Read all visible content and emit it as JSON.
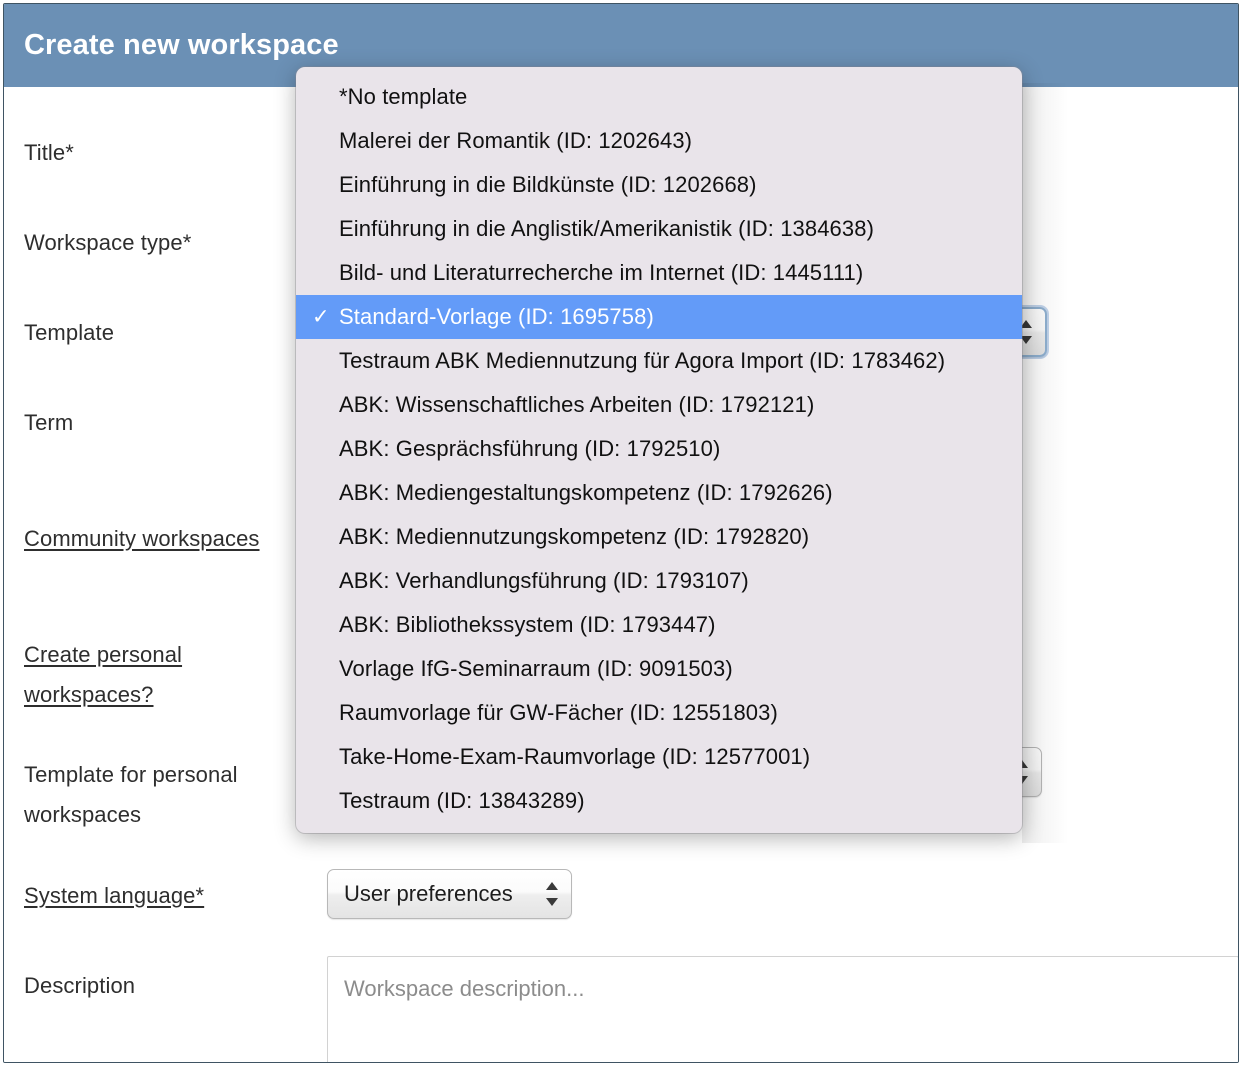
{
  "window": {
    "title": "Create new workspace"
  },
  "colors": {
    "titlebar": "#6b90b5",
    "menu_background": "#e9e4ea",
    "menu_selected": "#639bf8",
    "page_background": "#ffffff",
    "border": "#3f5463"
  },
  "form": {
    "fields": [
      {
        "label": "Title*",
        "link": false
      },
      {
        "label": "Workspace type*",
        "link": false
      },
      {
        "label": "Template",
        "link": false
      },
      {
        "label": "Term",
        "link": false
      },
      {
        "label": "Community workspaces",
        "link": true
      },
      {
        "label": "Create personal workspaces?",
        "link": true
      },
      {
        "label": "Template for personal workspaces",
        "link": false
      },
      {
        "label": "System language*",
        "link": true
      },
      {
        "label": "Description",
        "link": false
      }
    ],
    "system_language": {
      "value": "User preferences"
    },
    "description": {
      "placeholder": "Workspace description..."
    }
  },
  "template_dropdown": {
    "open": true,
    "selected_index": 5,
    "check_glyph": "✓",
    "items": [
      {
        "label": "*No template"
      },
      {
        "label": "Malerei der Romantik (ID: 1202643)"
      },
      {
        "label": "Einführung in die Bildkünste (ID: 1202668)"
      },
      {
        "label": "Einführung in die Anglistik/Amerikanistik (ID: 1384638)"
      },
      {
        "label": "Bild- und Literaturrecherche im Internet (ID: 1445111)"
      },
      {
        "label": "Standard-Vorlage (ID: 1695758)"
      },
      {
        "label": "Testraum ABK Mediennutzung für Agora Import (ID: 1783462)"
      },
      {
        "label": "ABK: Wissenschaftliches Arbeiten (ID: 1792121)"
      },
      {
        "label": "ABK: Gesprächsführung (ID: 1792510)"
      },
      {
        "label": "ABK: Mediengestaltungskompetenz (ID: 1792626)"
      },
      {
        "label": "ABK: Mediennutzungskompetenz (ID: 1792820)"
      },
      {
        "label": "ABK: Verhandlungsführung (ID: 1793107)"
      },
      {
        "label": "ABK: Bibliothekssystem (ID: 1793447)"
      },
      {
        "label": "Vorlage IfG-Seminarraum (ID: 9091503)"
      },
      {
        "label": "Raumvorlage für GW-Fächer (ID: 12551803)"
      },
      {
        "label": "Take-Home-Exam-Raumvorlage (ID: 12577001)"
      },
      {
        "label": "Testraum (ID: 13843289)"
      }
    ]
  }
}
